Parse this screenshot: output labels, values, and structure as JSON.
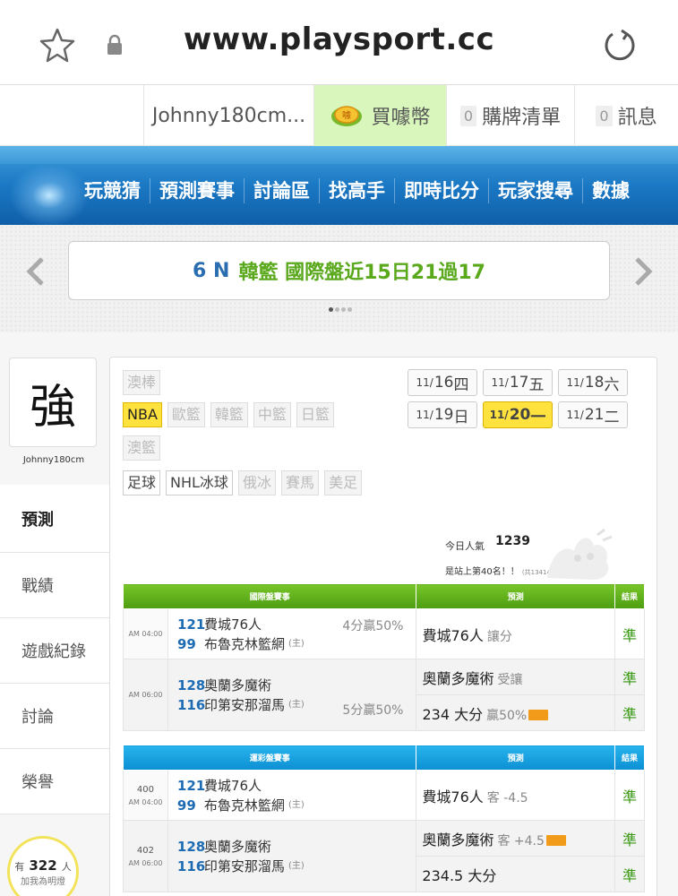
{
  "browser": {
    "url": "www.playsport.cc"
  },
  "userbar": {
    "username": "Johnny180cm...",
    "coins_label": "買噱幣",
    "coins_badge": "噱",
    "cart_count": "0",
    "cart_label": "購牌清單",
    "msg_count": "0",
    "msg_label": "訊息"
  },
  "nav": {
    "items": [
      "玩競猜",
      "預測賽事",
      "討論區",
      "找高手",
      "即時比分",
      "玩家搜尋",
      "數據"
    ]
  },
  "ticker": {
    "code": "6 N",
    "text": "韓籃 國際盤近15日21過17"
  },
  "profile": {
    "avatar_char": "強",
    "name": "Johnny180cm"
  },
  "sidemenu": [
    {
      "label": "預測",
      "active": true
    },
    {
      "label": "戰績"
    },
    {
      "label": "遊戲紀錄"
    },
    {
      "label": "討論"
    },
    {
      "label": "榮譽"
    }
  ],
  "fans": {
    "prefix": "有",
    "count": "322",
    "unit": "人",
    "cta": "加我為明燈"
  },
  "leagues": {
    "row1": [
      "澳棒"
    ],
    "row2": [
      "NBA",
      "歐籃",
      "韓籃",
      "中籃",
      "日籃"
    ],
    "row3": [
      "澳籃"
    ],
    "row4": [
      "足球",
      "NHL冰球",
      "俄冰",
      "賽馬",
      "美足"
    ],
    "enabled": [
      "NBA",
      "足球",
      "NHL冰球"
    ],
    "selected": "NBA"
  },
  "dates": [
    {
      "md": "11/",
      "d": "16",
      "wd": "四"
    },
    {
      "md": "11/",
      "d": "17",
      "wd": "五"
    },
    {
      "md": "11/",
      "d": "18",
      "wd": "六"
    },
    {
      "md": "11/",
      "d": "19",
      "wd": "日"
    },
    {
      "md": "11/",
      "d": "20",
      "wd": "一",
      "selected": true
    },
    {
      "md": "11/",
      "d": "21",
      "wd": "二"
    }
  ],
  "stats": {
    "pop_label": "今日人氣",
    "pop_count": "1239",
    "rank_text": "是站上第40名！！",
    "rank_small": "(共13414人)"
  },
  "table1": {
    "headers": [
      "國際盤賽事",
      "預測",
      "結果"
    ],
    "rows": [
      {
        "time": "AM 04:00",
        "teams": [
          {
            "num": "121",
            "name": "費城76人",
            "home": ""
          },
          {
            "num": "99",
            "name": "布魯克林籃網",
            "home": "(主)"
          }
        ],
        "note": "4分贏50%",
        "preds": [
          {
            "main": "費城76人",
            "sub": "讓分",
            "result": "準"
          }
        ]
      },
      {
        "time": "AM 06:00",
        "teams": [
          {
            "num": "128",
            "name": "奧蘭多魔術",
            "home": ""
          },
          {
            "num": "116",
            "name": "印第安那溜馬",
            "home": "(主)"
          }
        ],
        "note": "5分贏50%",
        "preds": [
          {
            "main": "奧蘭多魔術",
            "sub": "受讓",
            "result": "準"
          },
          {
            "main": "234 大分",
            "sub": "贏50%",
            "hot": true,
            "result": "準"
          }
        ]
      }
    ]
  },
  "table2": {
    "headers": [
      "運彩盤賽事",
      "預測",
      "結果"
    ],
    "rows": [
      {
        "num": "400",
        "time": "AM 04:00",
        "teams": [
          {
            "num": "121",
            "name": "費城76人",
            "home": ""
          },
          {
            "num": "99",
            "name": "布魯克林籃網",
            "home": "(主)"
          }
        ],
        "preds": [
          {
            "main": "費城76人",
            "sub": "客 -4.5",
            "result": "準"
          }
        ]
      },
      {
        "num": "402",
        "time": "AM 06:00",
        "teams": [
          {
            "num": "128",
            "name": "奧蘭多魔術",
            "home": ""
          },
          {
            "num": "116",
            "name": "印第安那溜馬",
            "home": "(主)"
          }
        ],
        "preds": [
          {
            "main": "奧蘭多魔術",
            "sub": "客 +4.5",
            "hot": true,
            "result": "準"
          },
          {
            "main": "234.5 大分",
            "sub": "",
            "result": "準"
          }
        ]
      }
    ]
  },
  "colors": {
    "green_header": "#5aad15",
    "blue_header": "#1aa2e0",
    "selected": "#ffe23e",
    "result": "#3a9a15"
  }
}
